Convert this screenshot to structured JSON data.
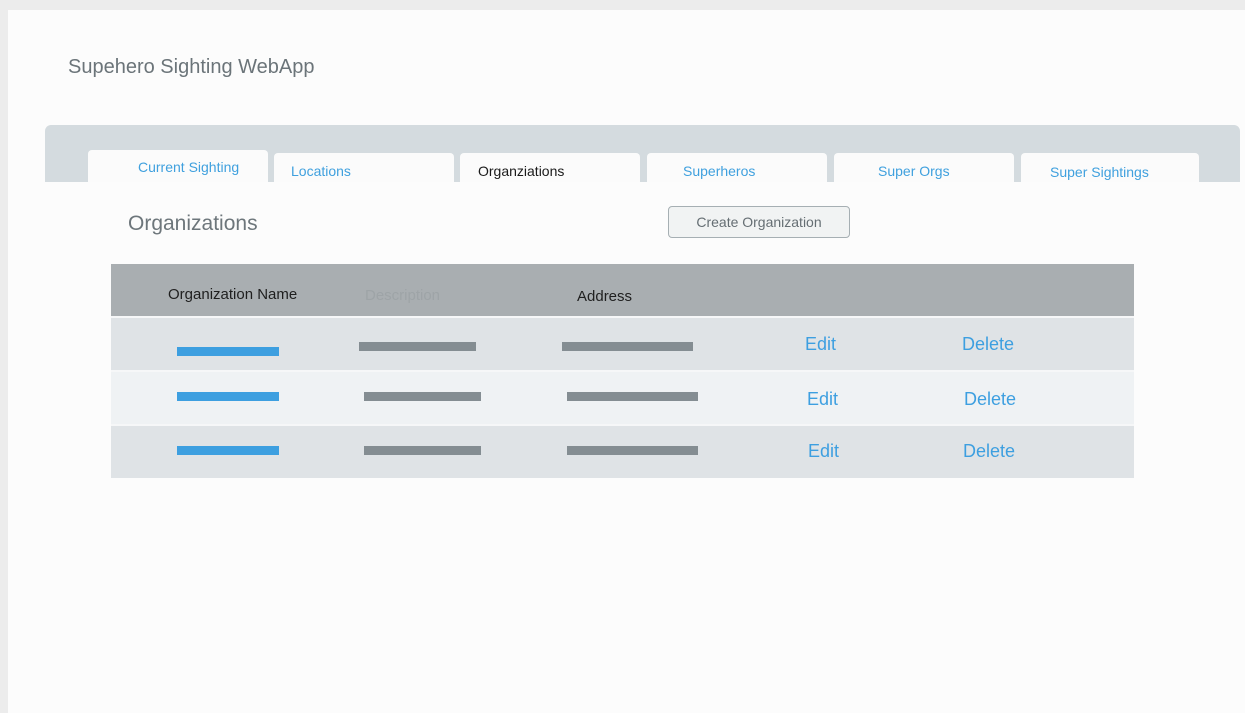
{
  "app": {
    "title": "Supehero Sighting WebApp"
  },
  "tabs": [
    {
      "label": "Current Sighting",
      "active": false
    },
    {
      "label": "Locations",
      "active": false
    },
    {
      "label": "Organziations",
      "active": true
    },
    {
      "label": "Superheros",
      "active": false
    },
    {
      "label": "Super Orgs",
      "active": false
    },
    {
      "label": "Super Sightings",
      "active": false
    }
  ],
  "main": {
    "title": "Organizations",
    "create_button_label": "Create Organization"
  },
  "table": {
    "headers": {
      "name": "Organization Name",
      "description": "Description",
      "address": "Address"
    },
    "rows": [
      {
        "edit": "Edit",
        "delete": "Delete"
      },
      {
        "edit": "Edit",
        "delete": "Delete"
      },
      {
        "edit": "Edit",
        "delete": "Delete"
      }
    ]
  },
  "colors": {
    "accent_blue": "#3d9fe0",
    "placeholder_gray": "#848d92",
    "header_gray": "#a9aeb1",
    "tabbar_bg": "#d4dbdf"
  }
}
